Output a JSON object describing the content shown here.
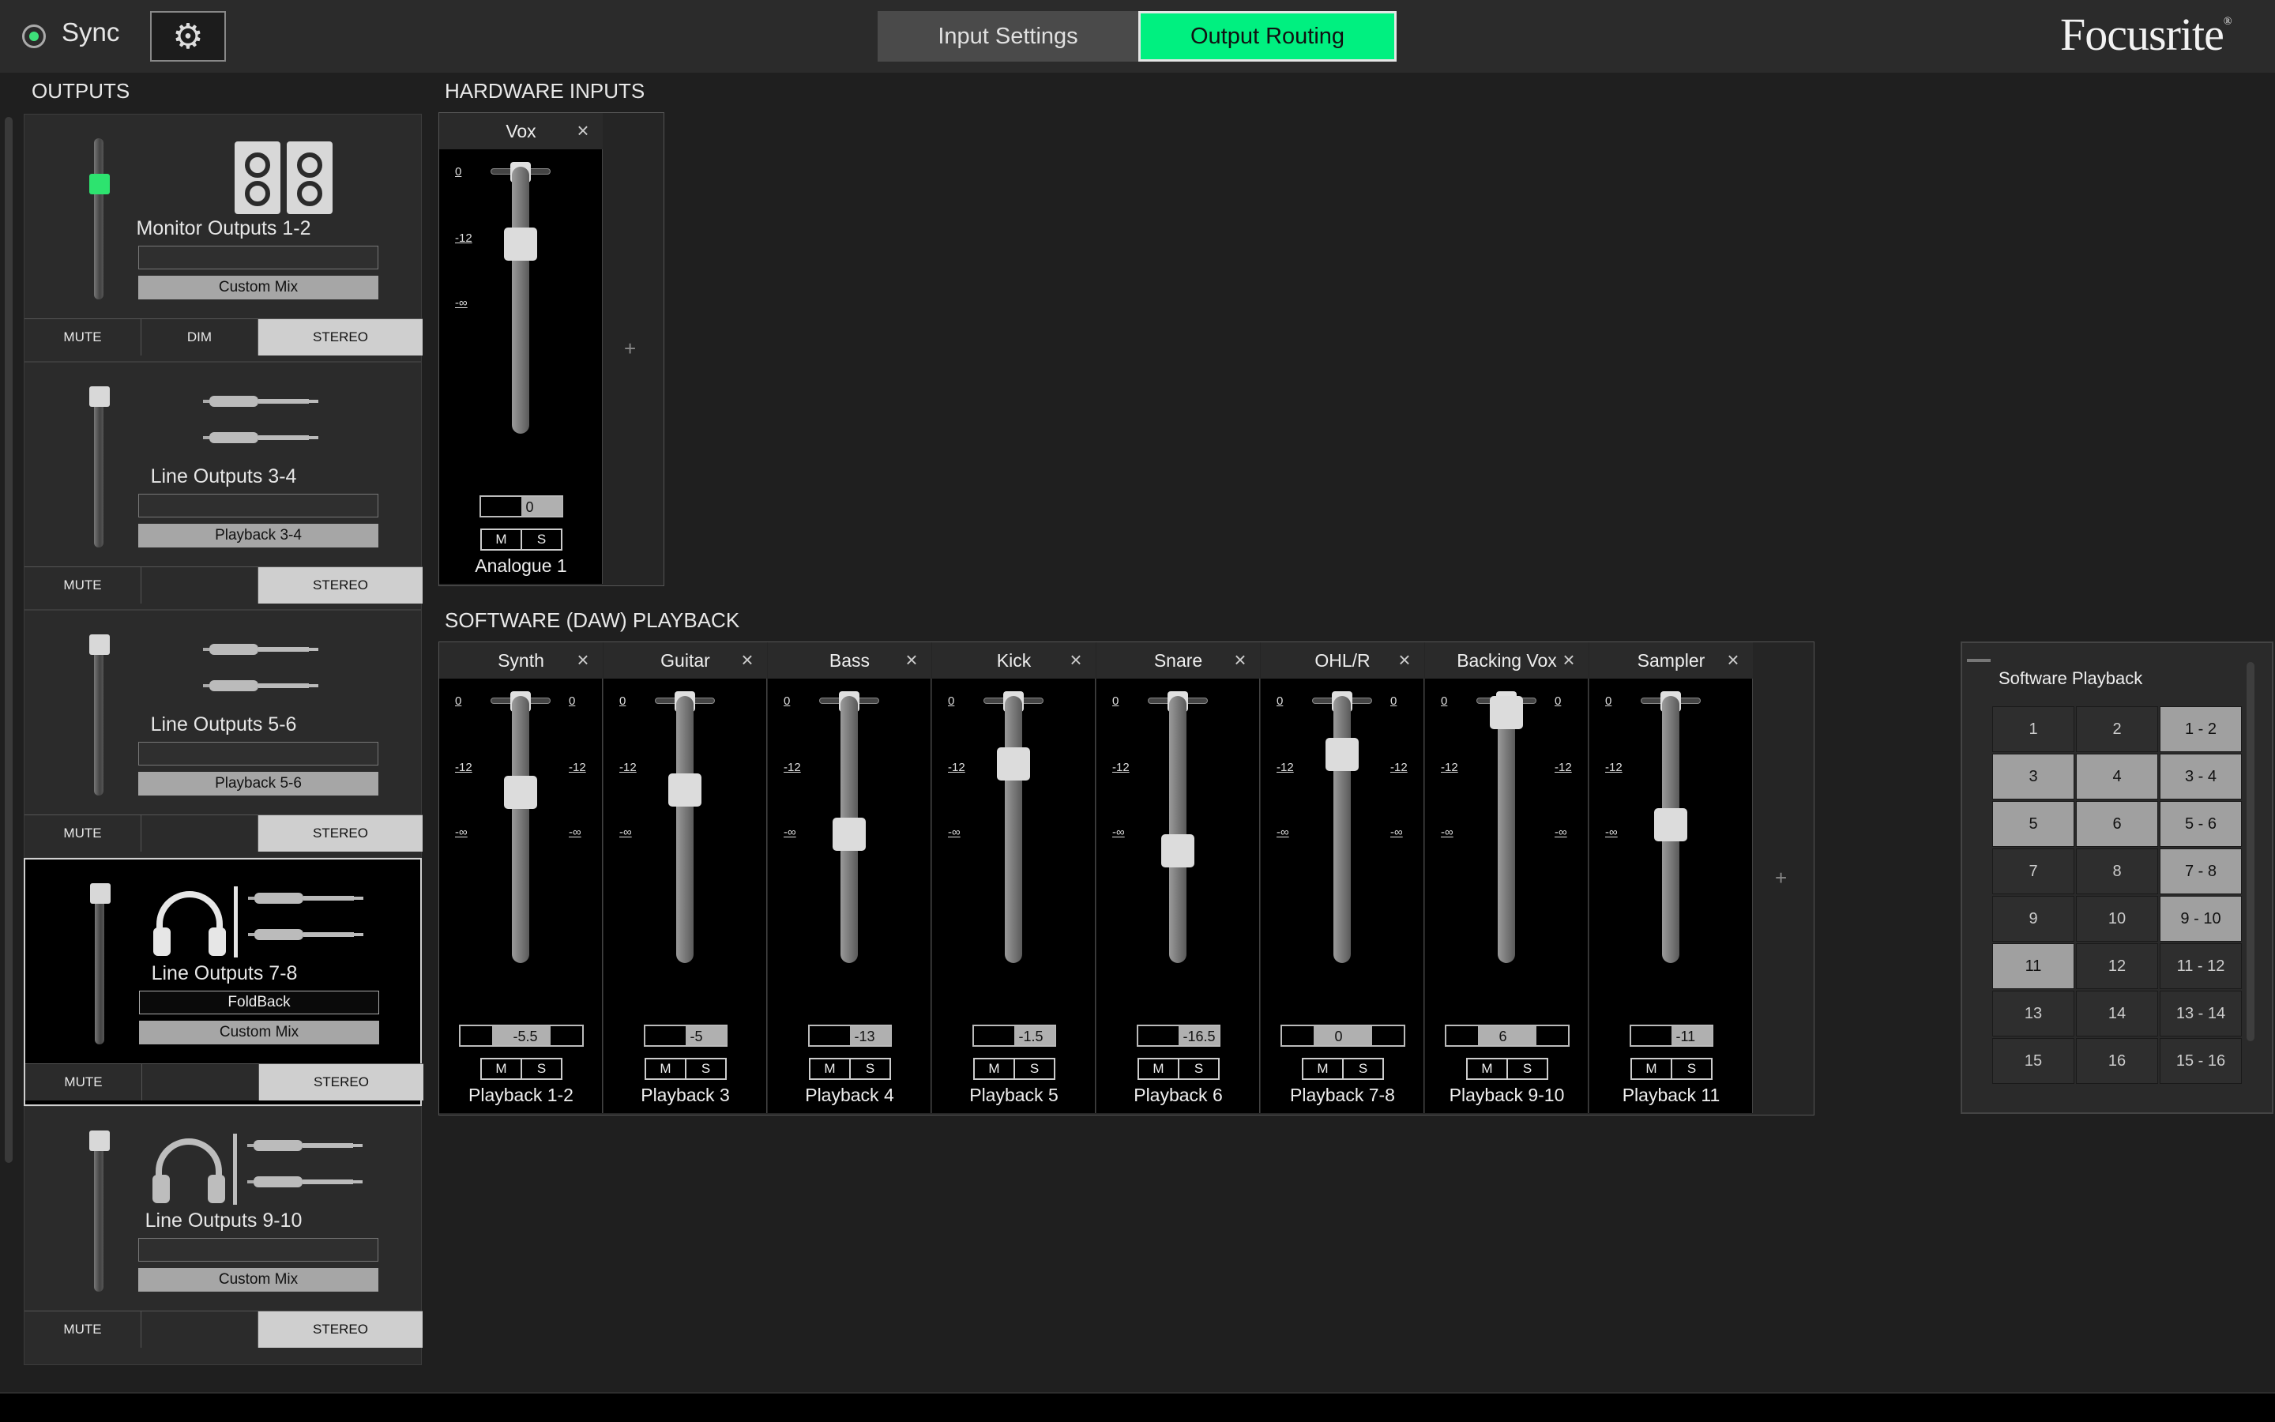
{
  "header": {
    "sync_label": "Sync",
    "settings_icon": "gear-icon",
    "tabs": [
      {
        "label": "Input Settings",
        "active": false
      },
      {
        "label": "Output Routing",
        "active": true
      }
    ],
    "brand": "Focusrite",
    "brand_mark": "®",
    "accent_color": "#00f080"
  },
  "outputs": {
    "title": "OUTPUTS",
    "strips": [
      {
        "name": "Monitor Outputs 1-2",
        "field": "",
        "mix": "Custom Mix",
        "icon": "speakers-icon",
        "level": 0.75,
        "buttons": [
          "MUTE",
          "DIM",
          "STEREO"
        ],
        "selected": false
      },
      {
        "name": "Line Outputs 3-4",
        "field": "",
        "mix": "Playback 3-4",
        "icon": "line-cables-icon",
        "level": 1.0,
        "buttons": [
          "MUTE",
          "STEREO"
        ],
        "selected": false
      },
      {
        "name": "Line Outputs 5-6",
        "field": "",
        "mix": "Playback 5-6",
        "icon": "line-cables-icon",
        "level": 1.0,
        "buttons": [
          "MUTE",
          "STEREO"
        ],
        "selected": false
      },
      {
        "name": "Line Outputs 7-8",
        "field": "FoldBack",
        "mix": "Custom Mix",
        "icon": "headphones-cables-icon",
        "level": 1.0,
        "buttons": [
          "MUTE",
          "STEREO"
        ],
        "selected": true
      },
      {
        "name": "Line Outputs 9-10",
        "field": "",
        "mix": "Custom Mix",
        "icon": "headphones-cables-icon",
        "level": 1.0,
        "buttons": [
          "MUTE",
          "STEREO"
        ],
        "selected": false
      }
    ]
  },
  "hardware_inputs": {
    "title": "HARDWARE INPUTS",
    "channels": [
      {
        "label": "Vox",
        "source": "Analogue 1",
        "value": "0",
        "fader": 0.74,
        "pan": 0.5,
        "stereo": false
      }
    ],
    "scale": [
      "0",
      "-12",
      "-∞"
    ],
    "add": "+"
  },
  "software_playback": {
    "title": "SOFTWARE (DAW) PLAYBACK",
    "channels": [
      {
        "label": "Synth",
        "source": "Playback 1-2",
        "value": "-5.5",
        "fader": 0.66,
        "pan": 0.5,
        "stereo": true
      },
      {
        "label": "Guitar",
        "source": "Playback 3",
        "value": "-5",
        "fader": 0.67,
        "pan": 0.5,
        "stereo": false
      },
      {
        "label": "Bass",
        "source": "Playback 4",
        "value": "-13",
        "fader": 0.48,
        "pan": 0.5,
        "stereo": false
      },
      {
        "label": "Kick",
        "source": "Playback 5",
        "value": "-1.5",
        "fader": 0.78,
        "pan": 0.5,
        "stereo": false
      },
      {
        "label": "Snare",
        "source": "Playback 6",
        "value": "-16.5",
        "fader": 0.41,
        "pan": 0.5,
        "stereo": false
      },
      {
        "label": "OHL/R",
        "source": "Playback 7-8",
        "value": "0",
        "fader": 0.82,
        "pan": 0.5,
        "stereo": true
      },
      {
        "label": "Backing Vox",
        "source": "Playback 9-10",
        "value": "6",
        "fader": 1.0,
        "pan": 0.5,
        "stereo": true
      },
      {
        "label": "Sampler",
        "source": "Playback 11",
        "value": "-11",
        "fader": 0.52,
        "pan": 0.5,
        "stereo": false
      }
    ],
    "scale": [
      "0",
      "-12",
      "-∞"
    ],
    "mute_label": "M",
    "solo_label": "S",
    "add": "+"
  },
  "source_picker": {
    "title": "Software Playback",
    "cells": [
      [
        "1",
        "2",
        "1 - 2"
      ],
      [
        "3",
        "4",
        "3 - 4"
      ],
      [
        "5",
        "6",
        "5 - 6"
      ],
      [
        "7",
        "8",
        "7 - 8"
      ],
      [
        "9",
        "10",
        "9 - 10"
      ],
      [
        "11",
        "12",
        "11 - 12"
      ],
      [
        "13",
        "14",
        "13 - 14"
      ],
      [
        "15",
        "16",
        "15 - 16"
      ]
    ],
    "highlighted": [
      [
        0,
        2
      ],
      [
        1,
        0
      ],
      [
        1,
        1
      ],
      [
        1,
        2
      ],
      [
        2,
        0
      ],
      [
        2,
        1
      ],
      [
        2,
        2
      ],
      [
        3,
        2
      ],
      [
        4,
        2
      ],
      [
        5,
        0
      ]
    ]
  }
}
